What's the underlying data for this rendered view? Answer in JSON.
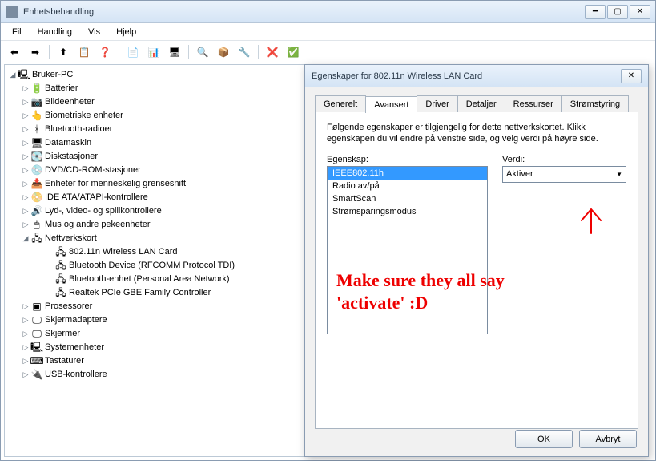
{
  "window": {
    "title": "Enhetsbehandling"
  },
  "menu": {
    "fil": "Fil",
    "handling": "Handling",
    "vis": "Vis",
    "hjelp": "Hjelp"
  },
  "toolbar_icons": [
    "⬅",
    "➡",
    "⬆",
    "📋",
    "❓",
    "📄",
    "📊",
    "🖥",
    "🔍",
    "📦",
    "🔧",
    "❌",
    "✅"
  ],
  "tree": {
    "root": {
      "label": "Bruker-PC",
      "icon": "🖳",
      "expanded": true
    },
    "items": [
      {
        "label": "Batterier",
        "icon": "🔋",
        "e": false
      },
      {
        "label": "Bildeenheter",
        "icon": "📷",
        "e": false
      },
      {
        "label": "Biometriske enheter",
        "icon": "👆",
        "e": false
      },
      {
        "label": "Bluetooth-radioer",
        "icon": "ᚼ",
        "e": false
      },
      {
        "label": "Datamaskin",
        "icon": "🖥",
        "e": false
      },
      {
        "label": "Diskstasjoner",
        "icon": "💽",
        "e": false
      },
      {
        "label": "DVD/CD-ROM-stasjoner",
        "icon": "💿",
        "e": false
      },
      {
        "label": "Enheter for menneskelig grensesnitt",
        "icon": "📥",
        "e": false
      },
      {
        "label": "IDE ATA/ATAPI-kontrollere",
        "icon": "📀",
        "e": false
      },
      {
        "label": "Lyd-, video- og spillkontrollere",
        "icon": "🔊",
        "e": false
      },
      {
        "label": "Mus og andre pekeenheter",
        "icon": "🖱",
        "e": false
      },
      {
        "label": "Nettverkskort",
        "icon": "🖧",
        "e": true,
        "children": [
          {
            "label": "802.11n Wireless LAN Card",
            "icon": "🖧"
          },
          {
            "label": "Bluetooth Device (RFCOMM Protocol TDI)",
            "icon": "🖧"
          },
          {
            "label": "Bluetooth-enhet (Personal Area Network)",
            "icon": "🖧"
          },
          {
            "label": "Realtek PCIe GBE Family Controller",
            "icon": "🖧"
          }
        ]
      },
      {
        "label": "Prosessorer",
        "icon": "▣",
        "e": false
      },
      {
        "label": "Skjermadaptere",
        "icon": "🖵",
        "e": false
      },
      {
        "label": "Skjermer",
        "icon": "🖵",
        "e": false
      },
      {
        "label": "Systemenheter",
        "icon": "🖳",
        "e": false
      },
      {
        "label": "Tastaturer",
        "icon": "⌨",
        "e": false
      },
      {
        "label": "USB-kontrollere",
        "icon": "🔌",
        "e": false
      }
    ]
  },
  "dialog": {
    "title": "Egenskaper for 802.11n Wireless LAN Card",
    "tabs": {
      "generelt": "Generelt",
      "avansert": "Avansert",
      "driver": "Driver",
      "detaljer": "Detaljer",
      "ressurser": "Ressurser",
      "strom": "Strømstyring"
    },
    "active_tab": "avansert",
    "description": "Følgende egenskaper er tilgjengelig for dette nettverkskortet. Klikk egenskapen du vil endre på venstre side, og velg verdi på høyre side.",
    "property_label": "Egenskap:",
    "value_label": "Verdi:",
    "properties": [
      "IEEE802.11h",
      "Radio av/på",
      "SmartScan",
      "Strømsparingsmodus"
    ],
    "selected_property": "IEEE802.11h",
    "value_selected": "Aktiver",
    "ok": "OK",
    "cancel": "Avbryt"
  },
  "annotation": {
    "text": "Make sure they all say\n'activate' :D"
  }
}
